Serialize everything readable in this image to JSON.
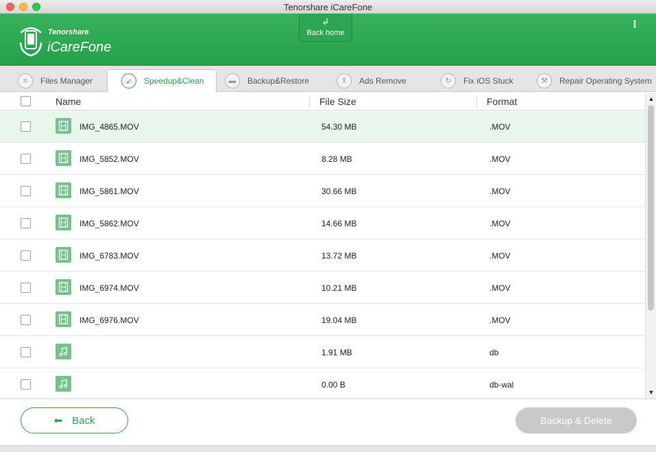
{
  "window": {
    "title": "Tenorshare iCareFone"
  },
  "brand": {
    "company": "Tenorshare",
    "product": "iCareFone"
  },
  "header": {
    "back_home_label": "Back home"
  },
  "tabs": [
    {
      "label": "Files Manager",
      "icon": "files-icon",
      "active": false
    },
    {
      "label": "Speedup&Clean",
      "icon": "rocket-icon",
      "active": true
    },
    {
      "label": "Backup&Restore",
      "icon": "folder-icon",
      "active": false
    },
    {
      "label": "Ads Remove",
      "icon": "trash-icon",
      "active": false
    },
    {
      "label": "Fix iOS Stuck",
      "icon": "refresh-icon",
      "active": false
    },
    {
      "label": "Repair Operating System",
      "icon": "wrench-icon",
      "active": false
    }
  ],
  "table": {
    "columns": {
      "name": "Name",
      "size": "File Size",
      "format": "Format"
    },
    "rows": [
      {
        "type": "video",
        "name": "IMG_4865.MOV",
        "size": "54.30 MB",
        "format": ".MOV",
        "selected": true
      },
      {
        "type": "video",
        "name": "IMG_5852.MOV",
        "size": "8.28 MB",
        "format": ".MOV"
      },
      {
        "type": "video",
        "name": "IMG_5861.MOV",
        "size": "30.66 MB",
        "format": ".MOV"
      },
      {
        "type": "video",
        "name": "IMG_5862.MOV",
        "size": "14.66 MB",
        "format": ".MOV"
      },
      {
        "type": "video",
        "name": "IMG_6783.MOV",
        "size": "13.72 MB",
        "format": ".MOV"
      },
      {
        "type": "video",
        "name": "IMG_6974.MOV",
        "size": "10.21 MB",
        "format": ".MOV"
      },
      {
        "type": "video",
        "name": "IMG_6976.MOV",
        "size": "19.04 MB",
        "format": ".MOV"
      },
      {
        "type": "audio",
        "name": "",
        "size": "1.91 MB",
        "format": "db"
      },
      {
        "type": "audio",
        "name": "",
        "size": "0.00 B",
        "format": "db-wal"
      }
    ]
  },
  "footer": {
    "back_label": "Back",
    "backup_delete_label": "Backup & Delete"
  },
  "colors": {
    "accent": "#2ea351",
    "header_green": "#2ca450",
    "selected_row": "#e9f6ec",
    "disabled_button": "#c9c9c9"
  }
}
